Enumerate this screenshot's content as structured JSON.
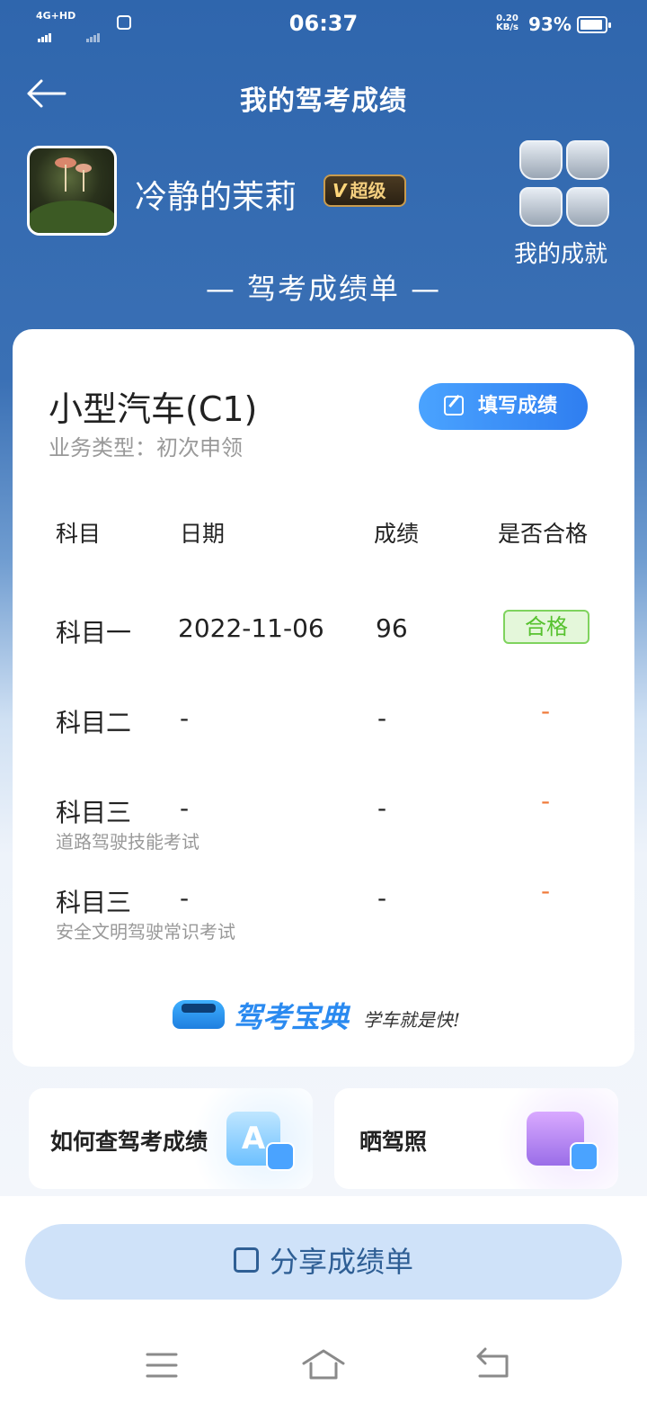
{
  "status_bar": {
    "network": "4G+HD",
    "time": "06:37",
    "speed_value": "0.20",
    "speed_unit": "KB/s",
    "battery": "93%",
    "battery_level": 0.93
  },
  "header": {
    "title": "我的驾考成绩"
  },
  "profile": {
    "username": "冷静的茉莉",
    "vip_label": "超级",
    "achievements_label": "我的成就"
  },
  "sheet_title": "— 驾考成绩单 —",
  "card": {
    "vehicle": "小型汽车(C1)",
    "business_type": "业务类型：初次申领",
    "fill_button": "填写成绩",
    "columns": [
      "科目",
      "日期",
      "成绩",
      "是否合格"
    ],
    "rows": [
      {
        "subject": "科目一",
        "sub_label": "",
        "date": "2022-11-06",
        "score": "96",
        "result": "合格"
      },
      {
        "subject": "科目二",
        "sub_label": "",
        "date": "-",
        "score": "-",
        "result": "-"
      },
      {
        "subject": "科目三",
        "sub_label": "道路驾驶技能考试",
        "date": "-",
        "score": "-",
        "result": "-"
      },
      {
        "subject": "科目三",
        "sub_label": "安全文明驾驶常识考试",
        "date": "-",
        "score": "-",
        "result": "-"
      }
    ],
    "brand_name": "驾考宝典",
    "brand_slogan": "学车就是快!"
  },
  "tiles": {
    "query": "如何查驾考成绩",
    "license": "晒驾照"
  },
  "share_button": "分享成绩单",
  "colors": {
    "header_blue": "#2f66ad",
    "accent_blue": "#2f7ef0",
    "pass_green": "#57c22f",
    "dash_orange": "#f07a3a"
  }
}
